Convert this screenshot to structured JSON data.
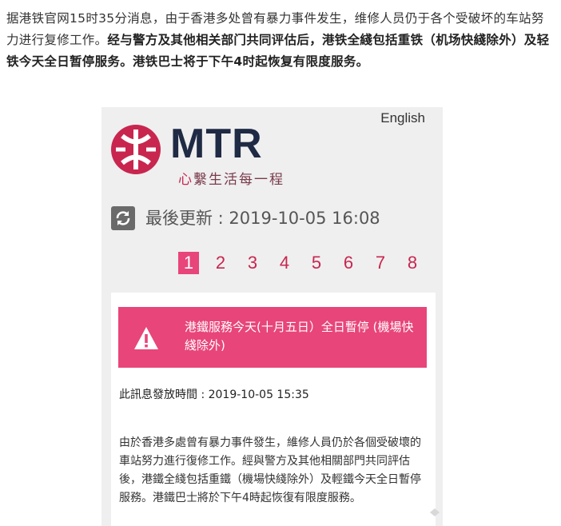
{
  "article": {
    "text_prefix": "据港铁官网15时35分消息，由于香港多处曾有暴力事件发生，维修人员仍于各个受破坏的车站努力进行复修工作。",
    "text_bold": "经与警方及其他相关部门共同评估后，港铁全綫包括重铁（机场快綫除外）及轻铁今天全日暂停服务。港铁巴士将于下午4时起恢复有限度服务。"
  },
  "mtr": {
    "language_link": "English",
    "logo_text": "MTR",
    "tagline_first": "心",
    "tagline_rest": "繫生活每一程",
    "updated_label": "最後更新 : 2019-10-05 16:08",
    "pages": [
      "1",
      "2",
      "3",
      "4",
      "5",
      "6",
      "7",
      "8"
    ],
    "active_page": "1",
    "alert_text": "港鐵服務今天(十月五日）全日暫停 (機場快綫除外)",
    "issued_label": "此訊息發放時間 : 2019-10-05 15:35",
    "body": "由於香港多處曾有暴力事件發生，維修人員仍於各個受破壞的車站努力進行復修工作。經與警方及其他相關部門共同評估後，港鐵全綫包括重鐵（機場快綫除外）及輕鐵今天全日暫停服務。港鐵巴士將於下午4時起恢復有限度服務。",
    "colors": {
      "brand_red": "#c8264f",
      "alert_pink": "#e8457a",
      "logo_navy": "#1f2a44"
    },
    "icons": [
      "mtr-logo-icon",
      "refresh-icon",
      "warning-icon"
    ]
  }
}
